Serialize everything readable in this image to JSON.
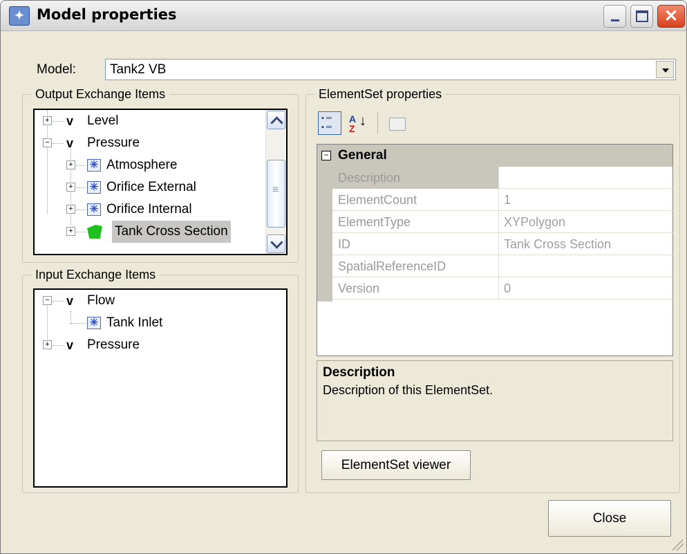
{
  "window": {
    "title": "Model properties",
    "app_icon": "model-app-icon",
    "controls": {
      "close_glyph": "✕"
    }
  },
  "model": {
    "label": "Model:",
    "selected": "Tank2 VB"
  },
  "output_group": {
    "legend": "Output Exchange Items",
    "items": [
      {
        "label": "Level",
        "type": "quantity",
        "expander": "+"
      },
      {
        "label": "Pressure",
        "type": "quantity",
        "expander": "−"
      },
      {
        "label": "Atmosphere",
        "type": "element-set",
        "expander": "+"
      },
      {
        "label": "Orifice External",
        "type": "element-set",
        "expander": "+"
      },
      {
        "label": "Orifice Internal",
        "type": "element-set",
        "expander": "+"
      },
      {
        "label": "Tank Cross Section",
        "type": "polygon-set",
        "expander": "+",
        "selected": true
      }
    ]
  },
  "input_group": {
    "legend": "Input Exchange Items",
    "items": [
      {
        "label": "Flow",
        "type": "quantity",
        "expander": "−"
      },
      {
        "label": "Tank Inlet",
        "type": "element-set"
      },
      {
        "label": "Pressure",
        "type": "quantity",
        "expander": "+"
      }
    ]
  },
  "quantity_glyph": "v",
  "element_set_glyph": "✳",
  "elementset_panel": {
    "legend": "ElementSet properties",
    "toolbar": {
      "categorized_icon": "categorized-icon",
      "alphabetical": {
        "a": "A",
        "z": "Z",
        "arrow": "↓"
      },
      "pages_icon": "property-pages-icon"
    },
    "category": {
      "toggle": "−",
      "name": "General"
    },
    "properties": [
      {
        "name": "Description",
        "value": ""
      },
      {
        "name": "ElementCount",
        "value": "1"
      },
      {
        "name": "ElementType",
        "value": "XYPolygon"
      },
      {
        "name": "ID",
        "value": "Tank Cross Section"
      },
      {
        "name": "SpatialReferenceID",
        "value": ""
      },
      {
        "name": "Version",
        "value": "0"
      }
    ],
    "description": {
      "title": "Description",
      "text": "Description of this ElementSet."
    },
    "viewer_button": "ElementSet viewer"
  },
  "close_button": "Close",
  "colors": {
    "dialog_bg": "#ece9d8",
    "selection": "#c7c6c4",
    "category_bg": "#c9c7bc",
    "close_red": "#d9421e"
  }
}
